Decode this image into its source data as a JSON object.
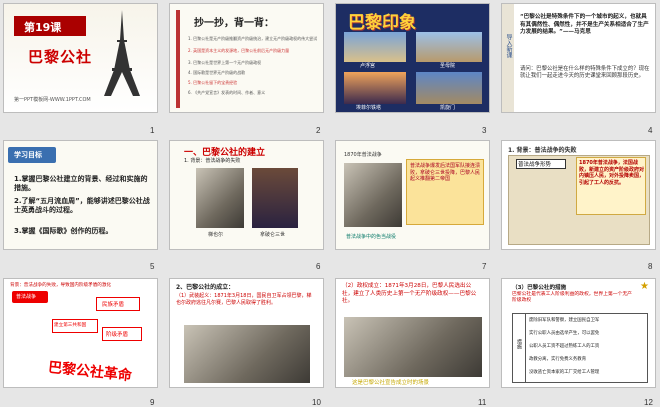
{
  "slides": [
    {
      "num": "1",
      "lesson": "第19课",
      "title": "巴黎公社",
      "footer": "第一PPT模板网-WWW.1PPT.COM"
    },
    {
      "num": "2",
      "heading": "抄一抄，背一背：",
      "items": [
        "1. 巴黎公社是无产阶级推翻资产阶级统治，建立无产阶级政权的伟大尝试",
        "2. 英国是资本主义的发源地，巴黎公社前后无产阶级力量",
        "3. 巴黎公社是世界上第一个无产阶级政权",
        "4. 国际歌是世界无产阶级的战歌",
        "5. 巴黎公社留下的宝贵经验",
        "6. 《共产党宣言》发表的时间、作者、意义"
      ]
    },
    {
      "num": "3",
      "title": "巴黎印象",
      "labels": [
        "卢浮宫",
        "圣母院",
        "埃菲尔铁塔",
        "凯旋门"
      ]
    },
    {
      "num": "4",
      "side": "导入新课",
      "quote": "“巴黎公社是特殊条件下的一个城市的起义，也就具有其偶然性、偶然性，并不是生产关系相适合了生产力发展的结果。”——马克思",
      "question": "请问：巴黎公社是在什么样的特殊条件下成立的？现在就让我们一起走进今天的历史课堂来回顾那段历史。"
    },
    {
      "num": "5",
      "badge": "学习目标",
      "goals": [
        "1.掌握巴黎公社建立的背景、经过和实施的措施。",
        "2.了解“五月流血周”，能够讲述巴黎公社战士英勇战斗的过程。",
        "3.掌握《国际歌》创作的历程。"
      ]
    },
    {
      "num": "6",
      "heading": "一、巴黎公社的建立",
      "sub": "1. 背景：普法战争的失败",
      "captions": [
        "梯也尔",
        "拿破仑三世"
      ]
    },
    {
      "num": "7",
      "banner": "1870年普法战争",
      "note": "普法战争爆发后法国军队接连溃败，拿破仑三世投降，巴黎人民起义推翻第二帝国",
      "footer": "普法战争中的色当战役"
    },
    {
      "num": "8",
      "heading": "1. 背景：普法战争的失败",
      "map_title": "普法战争形势",
      "callout": "1870年普法战争，法国战败，新建立的资产阶级政府对内镇压人民，对外投降卖国，引起了工人的反抗。"
    },
    {
      "num": "9",
      "heading": "背景：普法战争的失败，导致国内阶级矛盾的激化",
      "boxes": [
        "普法战争",
        "民族矛盾",
        "阶级矛盾"
      ],
      "center": "建立第三共和国",
      "big": "巴黎公社革命"
    },
    {
      "num": "10",
      "heading": "2、巴黎公社的成立：",
      "text": "（1）武装起义：1871年3月18日，国民自卫军占领巴黎，梯也尔政府逃往凡尔赛，巴黎人民取得了胜利。"
    },
    {
      "num": "11",
      "text": "（2）政权成立：1871年3月28日，巴黎人民选出公社，建立了人类历史上第一个无产阶级政权——巴黎公社。",
      "footer": "这是巴黎公社宣告成立时的场景"
    },
    {
      "num": "12",
      "heading": "（3）巴黎公社的措施",
      "text": "巴黎公社是代表工人阶级利益的政权，世界上第一个无产阶级政权",
      "side": "措施",
      "rows": [
        "废除旧军队和警察，建立国民自卫军",
        "实行公职人员由选举产生，可以罢免",
        "公职人员工资不超过熟练工人的工资",
        "政教分离，实行免费义务教育",
        "没收逃亡资本家的工厂交给工人管理"
      ]
    }
  ]
}
